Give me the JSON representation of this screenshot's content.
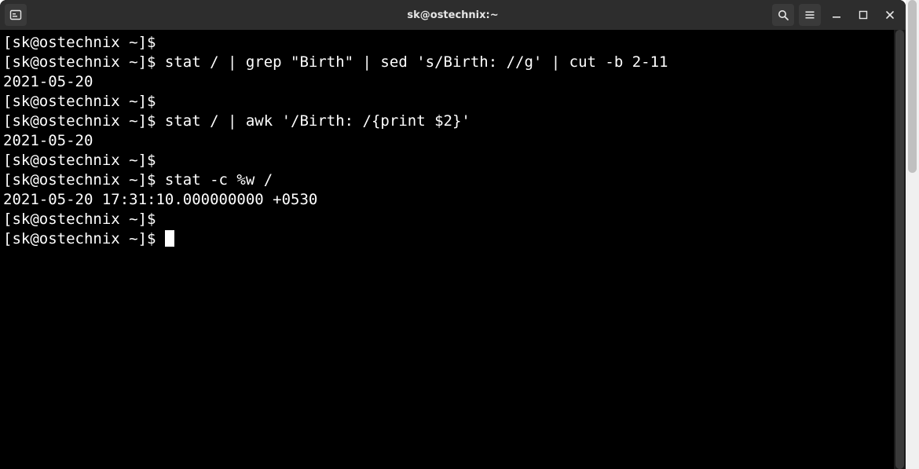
{
  "titlebar": {
    "title": "sk@ostechnix:~"
  },
  "terminal": {
    "prompt": "[sk@ostechnix ~]$ ",
    "lines": [
      {
        "kind": "prompt",
        "cmd": ""
      },
      {
        "kind": "prompt",
        "cmd": "stat / | grep \"Birth\" | sed 's/Birth: //g' | cut -b 2-11"
      },
      {
        "kind": "output",
        "text": "2021-05-20"
      },
      {
        "kind": "prompt",
        "cmd": ""
      },
      {
        "kind": "prompt",
        "cmd": "stat / | awk '/Birth: /{print $2}'"
      },
      {
        "kind": "output",
        "text": "2021-05-20"
      },
      {
        "kind": "prompt",
        "cmd": ""
      },
      {
        "kind": "prompt",
        "cmd": "stat -c %w /"
      },
      {
        "kind": "output",
        "text": "2021-05-20 17:31:10.000000000 +0530"
      },
      {
        "kind": "prompt",
        "cmd": ""
      },
      {
        "kind": "prompt_cursor",
        "cmd": ""
      }
    ]
  }
}
